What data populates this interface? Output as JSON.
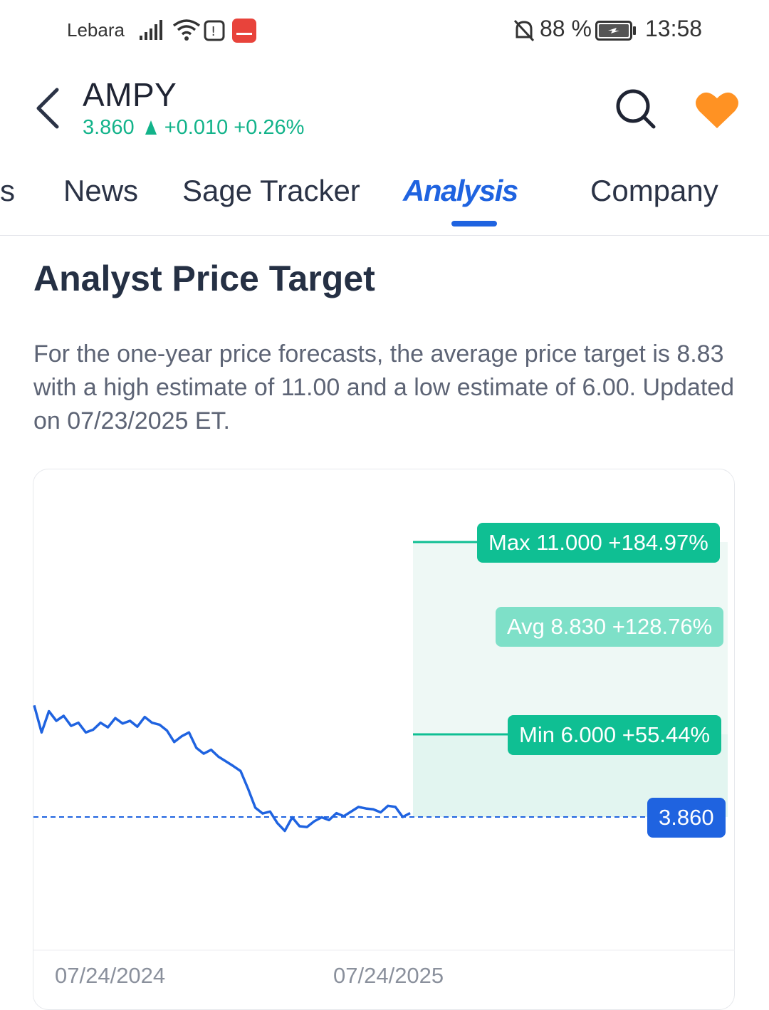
{
  "status_bar": {
    "carrier": "Lebara",
    "battery": "88 %",
    "time": "13:58"
  },
  "header": {
    "ticker": "AMPY",
    "price": "3.860",
    "change": "+0.010",
    "change_pct": "+0.26%"
  },
  "tabs": [
    {
      "label": "s"
    },
    {
      "label": "News"
    },
    {
      "label": "Sage Tracker"
    },
    {
      "label": "Analysis"
    },
    {
      "label": "Company"
    }
  ],
  "section": {
    "title": "Analyst Price Target",
    "description": "For the one-year price forecasts, the average price target is 8.83 with a high estimate of 11.00 and a low estimate of 6.00. Updated on 07/23/2025 ET."
  },
  "colors": {
    "accent": "#1f63e0",
    "up_green": "#12b38a",
    "target_green": "#0fbf93",
    "avg_green": "#7ee0c8",
    "favorite": "#ff9223"
  },
  "chart_data": {
    "type": "line",
    "x_ticks": [
      "07/24/2024",
      "07/24/2025"
    ],
    "series": [
      {
        "values": [
          6.75,
          6.05,
          6.6,
          6.35,
          6.48,
          6.22,
          6.3,
          6.05,
          6.12,
          6.3,
          6.18,
          6.42,
          6.28,
          6.35,
          6.2,
          6.45,
          6.3,
          6.25,
          6.1,
          5.8,
          5.95,
          6.05,
          5.65,
          5.5,
          5.6,
          5.42,
          5.3,
          5.18,
          5.05,
          4.6,
          4.1,
          3.95,
          4.0,
          3.7,
          3.5,
          3.85,
          3.62,
          3.6,
          3.75,
          3.85,
          3.78,
          3.96,
          3.88,
          4.0,
          4.12,
          4.08,
          4.06,
          3.98,
          4.15,
          4.12,
          3.86,
          3.96
        ]
      }
    ],
    "current_price": {
      "label": "3.860",
      "value": 3.86
    },
    "targets": [
      {
        "name": "Max",
        "value": "11.000",
        "pct": "+184.97%"
      },
      {
        "name": "Avg",
        "value": "8.830",
        "pct": "+128.76%"
      },
      {
        "name": "Min",
        "value": "6.000",
        "pct": "+55.44%"
      }
    ]
  }
}
